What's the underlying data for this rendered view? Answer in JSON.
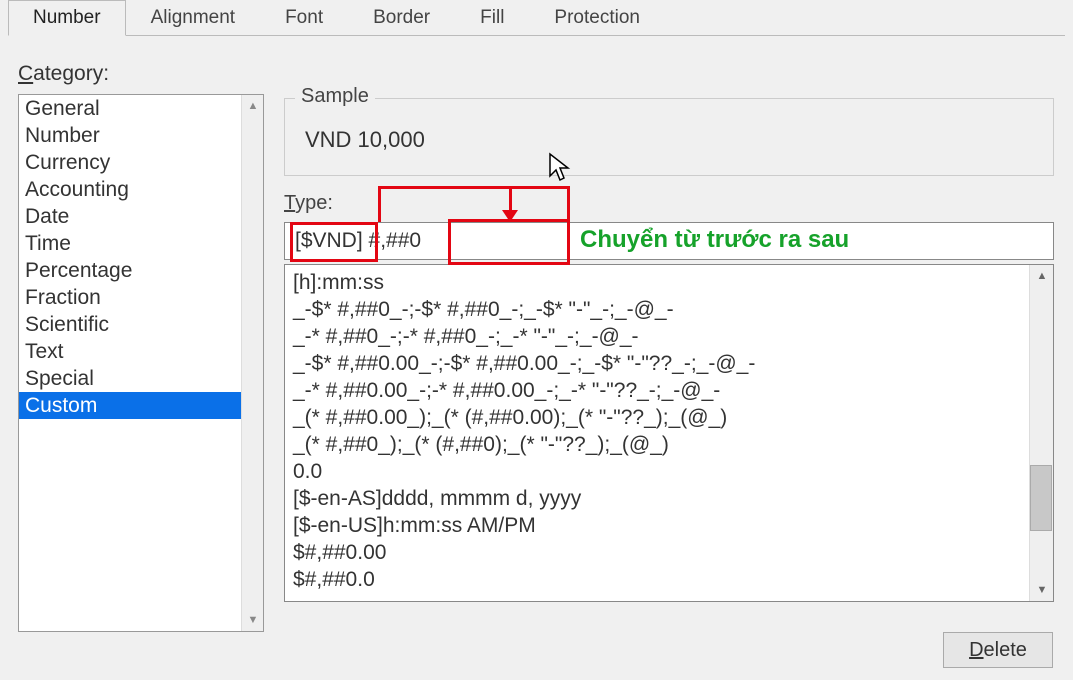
{
  "tabs": [
    "Number",
    "Alignment",
    "Font",
    "Border",
    "Fill",
    "Protection"
  ],
  "active_tab_index": 0,
  "labels": {
    "category": "Category:",
    "category_accel": "C",
    "sample": "Sample",
    "type": "Type:",
    "type_accel": "T",
    "delete": "Delete",
    "delete_accel": "D"
  },
  "categories": [
    "General",
    "Number",
    "Currency",
    "Accounting",
    "Date",
    "Time",
    "Percentage",
    "Fraction",
    "Scientific",
    "Text",
    "Special",
    "Custom"
  ],
  "selected_category_index": 11,
  "sample_value": "VND 10,000",
  "type_value": "[$VND] #,##0",
  "format_list": [
    "[h]:mm:ss",
    "_-$* #,##0_-;-$* #,##0_-;_-$* \"-\"_-;_-@_-",
    "_-* #,##0_-;-* #,##0_-;_-* \"-\"_-;_-@_-",
    "_-$* #,##0.00_-;-$* #,##0.00_-;_-$* \"-\"??_-;_-@_-",
    "_-* #,##0.00_-;-* #,##0.00_-;_-* \"-\"??_-;_-@_-",
    "_(* #,##0.00_);_(* (#,##0.00);_(* \"-\"??_);_(@_)",
    "_(* #,##0_);_(* (#,##0);_(* \"-\"??_);_(@_)",
    "0.0",
    "[$-en-AS]dddd, mmmm d, yyyy",
    "[$-en-US]h:mm:ss AM/PM",
    "$#,##0.00",
    "$#,##0.0"
  ],
  "annotation_text": "Chuyển từ trước ra sau"
}
